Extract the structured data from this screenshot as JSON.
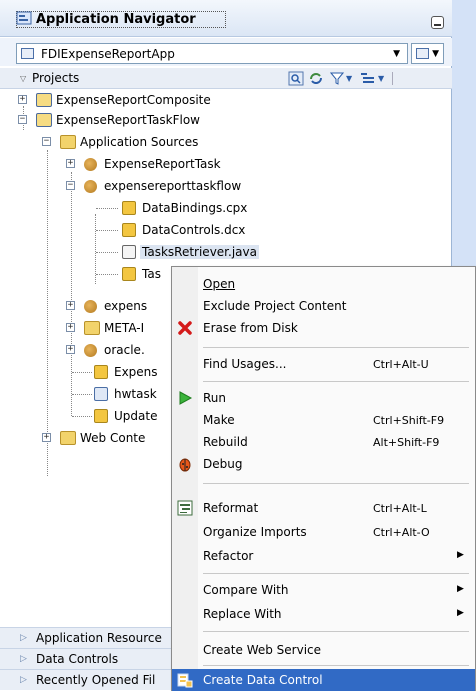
{
  "navigator": {
    "title": "Application Navigator",
    "application": "FDIExpenseReportApp",
    "projects_label": "Projects"
  },
  "tree": [
    {
      "label": "ExpenseReportComposite",
      "icon": "project-icon"
    },
    {
      "label": "ExpenseReportTaskFlow",
      "icon": "project-icon"
    },
    {
      "label": "Application Sources",
      "icon": "folder-icon"
    },
    {
      "label": "ExpenseReportTask",
      "icon": "package-icon"
    },
    {
      "label": "expensereporttaskflow",
      "icon": "package-icon"
    },
    {
      "label": "DataBindings.cpx",
      "icon": "file-icon"
    },
    {
      "label": "DataControls.dcx",
      "icon": "file-icon"
    },
    {
      "label": "TasksRetriever.java",
      "icon": "java-file-icon"
    },
    {
      "label": "Tas",
      "icon": "file-icon"
    },
    {
      "label": "expens",
      "icon": "package-icon"
    },
    {
      "label": "META-I",
      "icon": "folder-icon"
    },
    {
      "label": "oracle.",
      "icon": "package-icon"
    },
    {
      "label": "Expens",
      "icon": "file-icon"
    },
    {
      "label": "hwtask",
      "icon": "xml-file-icon"
    },
    {
      "label": "Update",
      "icon": "file-icon"
    },
    {
      "label": "Web Conte",
      "icon": "folder-icon"
    }
  ],
  "accordion": [
    "Application Resource",
    "Data Controls",
    "Recently Opened Fil"
  ],
  "menu": [
    {
      "label": "Open",
      "shortcut": "",
      "submenu": false,
      "icon": ""
    },
    {
      "label": "Exclude Project Content",
      "shortcut": "",
      "submenu": false,
      "icon": ""
    },
    {
      "label": "Erase from Disk",
      "shortcut": "",
      "submenu": false,
      "icon": "delete-x-icon"
    },
    {
      "label": "Find Usages...",
      "shortcut": "Ctrl+Alt-U",
      "submenu": false,
      "icon": ""
    },
    {
      "label": "Run",
      "shortcut": "",
      "submenu": false,
      "icon": "run-arrow-icon"
    },
    {
      "label": "Make",
      "shortcut": "Ctrl+Shift-F9",
      "submenu": false,
      "icon": ""
    },
    {
      "label": "Rebuild",
      "shortcut": "Alt+Shift-F9",
      "submenu": false,
      "icon": ""
    },
    {
      "label": "Debug",
      "shortcut": "",
      "submenu": false,
      "icon": "debug-bug-icon"
    },
    {
      "label": "Reformat",
      "shortcut": "Ctrl+Alt-L",
      "submenu": false,
      "icon": "reformat-icon"
    },
    {
      "label": "Organize Imports",
      "shortcut": "Ctrl+Alt-O",
      "submenu": false,
      "icon": ""
    },
    {
      "label": "Refactor",
      "shortcut": "",
      "submenu": true,
      "icon": ""
    },
    {
      "label": "Compare With",
      "shortcut": "",
      "submenu": true,
      "icon": ""
    },
    {
      "label": "Replace With",
      "shortcut": "",
      "submenu": true,
      "icon": ""
    },
    {
      "label": "Create Web Service",
      "shortcut": "",
      "submenu": false,
      "icon": ""
    },
    {
      "label": "Create Data Control",
      "shortcut": "",
      "submenu": false,
      "icon": "data-control-icon"
    }
  ],
  "colors": {
    "highlight": "#316ac5",
    "panel": "#e9eef6"
  }
}
